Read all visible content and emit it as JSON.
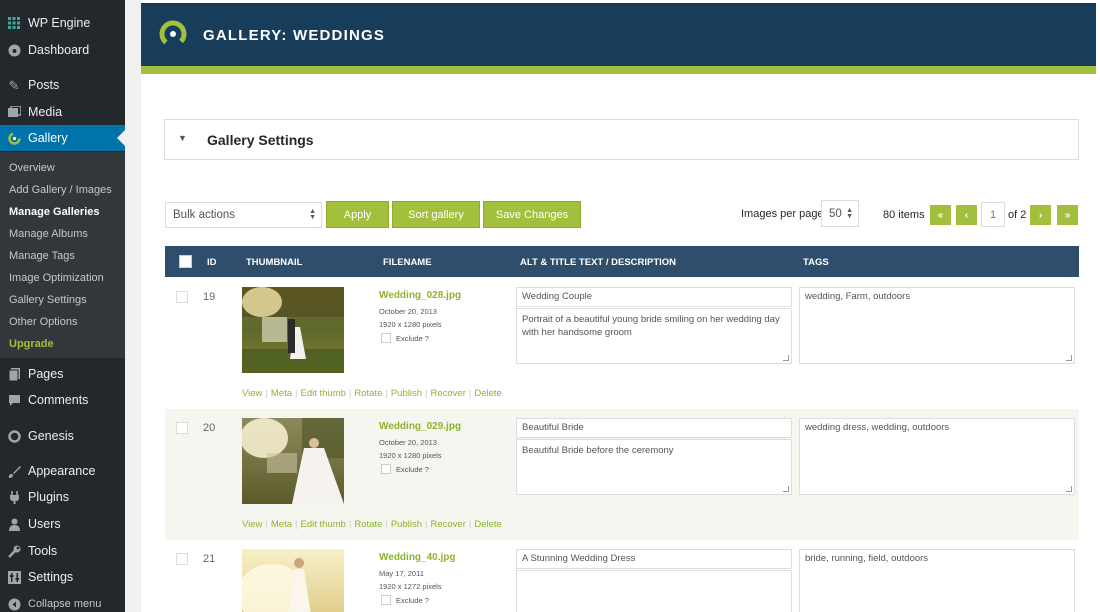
{
  "sidebar": {
    "items": [
      {
        "label": "WP Engine",
        "icon": "grid-icon"
      },
      {
        "label": "Dashboard",
        "icon": "dashboard-icon"
      },
      {
        "label": "Posts",
        "icon": "pushpin-icon"
      },
      {
        "label": "Media",
        "icon": "media-icon"
      },
      {
        "label": "Gallery",
        "icon": "gallery-icon"
      },
      {
        "label": "Pages",
        "icon": "pages-icon"
      },
      {
        "label": "Comments",
        "icon": "comment-icon"
      },
      {
        "label": "Genesis",
        "icon": "genesis-icon"
      },
      {
        "label": "Appearance",
        "icon": "brush-icon"
      },
      {
        "label": "Plugins",
        "icon": "plug-icon"
      },
      {
        "label": "Users",
        "icon": "user-icon"
      },
      {
        "label": "Tools",
        "icon": "wrench-icon"
      },
      {
        "label": "Settings",
        "icon": "settings-icon"
      },
      {
        "label": "Collapse menu",
        "icon": "collapse-icon"
      }
    ],
    "submenu": [
      {
        "label": "Overview"
      },
      {
        "label": "Add Gallery / Images"
      },
      {
        "label": "Manage Galleries"
      },
      {
        "label": "Manage Albums"
      },
      {
        "label": "Manage Tags"
      },
      {
        "label": "Image Optimization"
      },
      {
        "label": "Gallery Settings"
      },
      {
        "label": "Other Options"
      },
      {
        "label": "Upgrade"
      }
    ]
  },
  "header": {
    "title": "GALLERY: WEDDINGS"
  },
  "settings_panel": {
    "title": "Gallery Settings"
  },
  "toolbar": {
    "bulk_actions": "Bulk actions",
    "apply": "Apply",
    "sort": "Sort gallery",
    "save": "Save Changes",
    "per_page_label": "Images per page:",
    "per_page_value": "50",
    "items_count": "80 items",
    "page_current": "1",
    "page_of": "of 2",
    "first": "«",
    "prev": "‹",
    "next": "›",
    "last": "»"
  },
  "table": {
    "columns": [
      "ID",
      "THUMBNAIL",
      "FILENAME",
      "ALT & TITLE TEXT / DESCRIPTION",
      "TAGS"
    ],
    "exclude_label": "Exclude ?",
    "actions": [
      "View",
      "Meta",
      "Edit thumb",
      "Rotate",
      "Publish",
      "Recover",
      "Delete"
    ],
    "rows": [
      {
        "id": "19",
        "filename": "Wedding_028.jpg",
        "date": "October 20, 2013",
        "size": "1920 x 1280 pixels",
        "alt_title": "Wedding Couple",
        "description": "Portrait of a beautiful young bride smiling on her wedding day with her handsome groom",
        "tags": "wedding, Farm, outdoors"
      },
      {
        "id": "20",
        "filename": "Wedding_029.jpg",
        "date": "October 20, 2013",
        "size": "1920 x 1280 pixels",
        "alt_title": "Beautiful Bride",
        "description": "Beautiful Bride before the ceremony",
        "tags": "wedding dress, wedding, outdoors"
      },
      {
        "id": "21",
        "filename": "Wedding_40.jpg",
        "date": "May 17, 2011",
        "size": "1920 x 1272 pixels",
        "alt_title": "A Stunning Wedding Dress",
        "description": "",
        "tags": "bride, running, field, outdoors"
      }
    ]
  },
  "colors": {
    "accent_green": "#a2c03b",
    "banner_navy": "#173d5b",
    "table_header": "#2f4e6c",
    "wp_blue": "#0073aa"
  }
}
